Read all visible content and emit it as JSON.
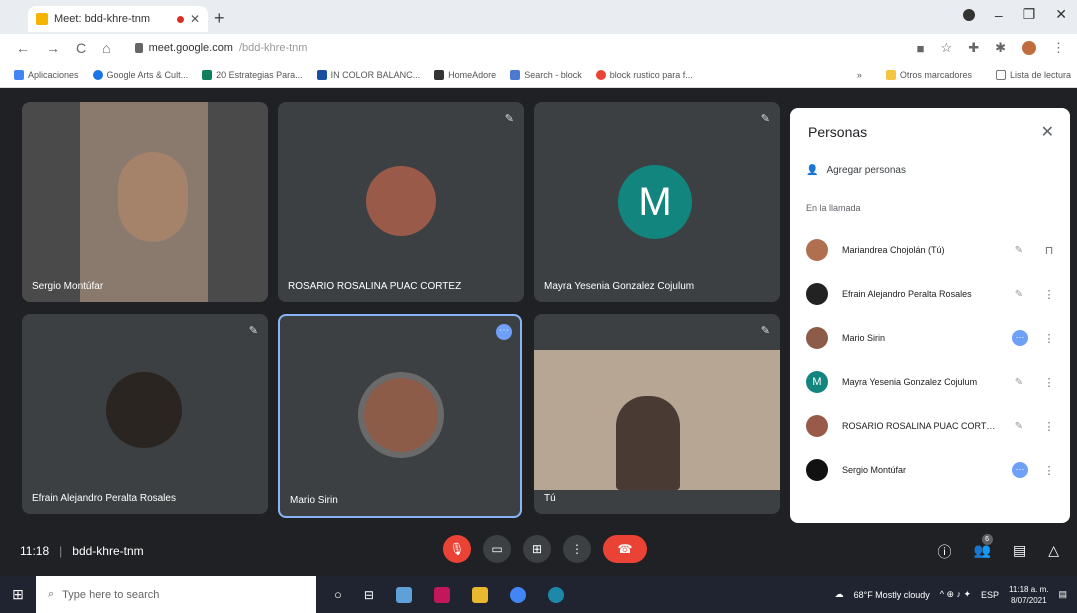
{
  "browser": {
    "tab_title": "Meet: bdd-khre-tnm",
    "new_tab": "+",
    "url_host": "meet.google.com",
    "url_path": "/bdd-khre-tnm",
    "bookmarks": [
      "Aplicaciones",
      "Google Arts & Cult...",
      "20 Estrategias Para...",
      "IN COLOR BALANC...",
      "HomeAdore",
      "Search - block",
      "block rustico para f..."
    ],
    "other_bookmarks": "Otros marcadores",
    "reading_list": "Lista de lectura"
  },
  "tiles": [
    {
      "name": "Sergio Montúfar"
    },
    {
      "name": "ROSARIO ROSALINA PUAC CORTEZ"
    },
    {
      "name": "Mayra Yesenia Gonzalez Cojulum",
      "letter": "M"
    },
    {
      "name": "Efrain Alejandro Peralta Rosales"
    },
    {
      "name": "Mario Sirin"
    },
    {
      "name": "Tú"
    }
  ],
  "panel": {
    "title": "Personas",
    "add": "Agregar personas",
    "in_call": "En la llamada",
    "people": [
      {
        "name": "Mariandrea Chojolán (Tú)"
      },
      {
        "name": "Efrain Alejandro Peralta Rosales"
      },
      {
        "name": "Mario Sirin"
      },
      {
        "name": "Mayra Yesenia Gonzalez Cojulum",
        "letter": "M"
      },
      {
        "name": "ROSARIO ROSALINA PUAC CORTEZ"
      },
      {
        "name": "Sergio Montúfar"
      }
    ]
  },
  "meeting": {
    "time": "11:18",
    "separator": "|",
    "code": "bdd-khre-tnm",
    "participants_count": "6"
  },
  "taskbar": {
    "search_placeholder": "Type here to search",
    "weather": "68°F  Mostly cloudy",
    "lang": "ESP",
    "time": "11:18 a. m.",
    "date": "8/07/2021"
  }
}
